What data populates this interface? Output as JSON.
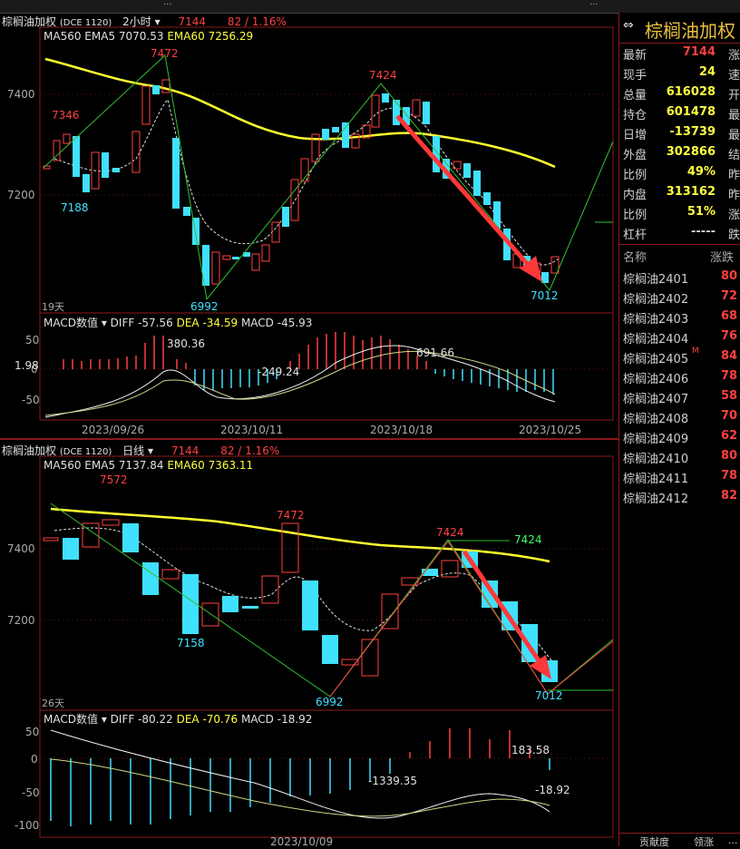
{
  "top_bar": {
    "partial_text": "...",
    "right_text": "..."
  },
  "chart1": {
    "header": {
      "name": "棕榈油加权",
      "code": "(DCE 1120)",
      "period": "2小时",
      "price": "7144",
      "change": "82 / 1.16%"
    },
    "ma_line": {
      "ma": "MA560",
      "ema5": "EMA5 7070.53",
      "ema60": "EMA60 7256.29"
    },
    "y_ticks": [
      "7400",
      "7200"
    ],
    "labels": {
      "p7472": "7472",
      "p7346": "7346",
      "p7188": "7188",
      "p6992": "6992",
      "p7424": "7424",
      "p7012": "7012"
    },
    "days": "19天",
    "macd_line": {
      "name": "MACD数值",
      "diff": "DIFF -57.56",
      "dea": "DEA -34.59",
      "macd": "MACD -45.93"
    },
    "macd_ticks": [
      "50",
      "0",
      "-50"
    ],
    "macd_labels": {
      "a": "1.98",
      "b": "380.36",
      "c": "-249.24",
      "d": "691.66"
    },
    "dates": [
      "2023/09/26",
      "2023/10/11",
      "2023/10/18",
      "2023/10/25"
    ]
  },
  "chart2": {
    "header": {
      "name": "棕榈油加权",
      "code": "(DCE 1120)",
      "period": "日线",
      "price": "7144",
      "change": "82 / 1.16%"
    },
    "ma_line": {
      "ma": "MA560",
      "ema5": "EMA5 7137.84",
      "ema60": "EMA60 7363.11"
    },
    "y_ticks": [
      "7400",
      "7200"
    ],
    "labels": {
      "p7572": "7572",
      "p7472": "7472",
      "p7424": "7424",
      "p7424b": "7424",
      "p7158": "7158",
      "p6992": "6992",
      "p7012": "7012"
    },
    "days": "26天",
    "macd_line": {
      "name": "MACD数值",
      "diff": "DIFF -80.22",
      "dea": "DEA -70.76",
      "macd": "MACD -18.92"
    },
    "macd_ticks": [
      "50",
      "0",
      "-50",
      "-100"
    ],
    "macd_labels": {
      "a": "183.58",
      "b": "-1339.35",
      "c": "-18.92"
    },
    "dates": [
      "2023/10/09"
    ]
  },
  "side": {
    "title": "棕榈油加权",
    "quote": [
      {
        "label": "最新",
        "value": "7144",
        "color": "#ff4040",
        "extra": "涨"
      },
      {
        "label": "现手",
        "value": "24",
        "color": "#ffff40",
        "extra": "速"
      },
      {
        "label": "总量",
        "value": "616028",
        "color": "#ffff40",
        "extra": "开"
      },
      {
        "label": "持仓",
        "value": "601478",
        "color": "#ffff40",
        "extra": "最"
      },
      {
        "label": "日增",
        "value": "-13739",
        "color": "#ffff40",
        "extra": "最"
      },
      {
        "label": "外盘",
        "value": "302866",
        "color": "#ffff40",
        "extra": "结"
      },
      {
        "label": "比例",
        "value": "49%",
        "color": "#ffff40",
        "extra": "昨"
      },
      {
        "label": "内盘",
        "value": "313162",
        "color": "#ffff40",
        "extra": "昨"
      },
      {
        "label": "比例",
        "value": "51%",
        "color": "#ffff40",
        "extra": "涨"
      },
      {
        "label": "杠杆",
        "value": "-----",
        "color": "#d0d0d0",
        "extra": "跌"
      }
    ],
    "list_header": {
      "name": "名称",
      "change": "涨跌"
    },
    "list": [
      {
        "name": "棕榈油2401",
        "change": "80"
      },
      {
        "name": "棕榈油2402",
        "change": "72"
      },
      {
        "name": "棕榈油2403",
        "change": "68"
      },
      {
        "name": "棕榈油2404",
        "change": "76"
      },
      {
        "name": "棕榈油2405",
        "change": "84",
        "mark": "M"
      },
      {
        "name": "棕榈油2406",
        "change": "78"
      },
      {
        "name": "棕榈油2407",
        "change": "58"
      },
      {
        "name": "棕榈油2408",
        "change": "70"
      },
      {
        "name": "棕榈油2409",
        "change": "62"
      },
      {
        "name": "棕榈油2410",
        "change": "80"
      },
      {
        "name": "棕榈油2411",
        "change": "78"
      },
      {
        "name": "棕榈油2412",
        "change": "82"
      }
    ],
    "bottom_tabs": [
      "贡献度",
      "领涨",
      "..."
    ]
  },
  "colors": {
    "up": "#ff4040",
    "down": "#40e0ff",
    "ema60": "#ffff30",
    "frame": "#8b1a1a"
  }
}
